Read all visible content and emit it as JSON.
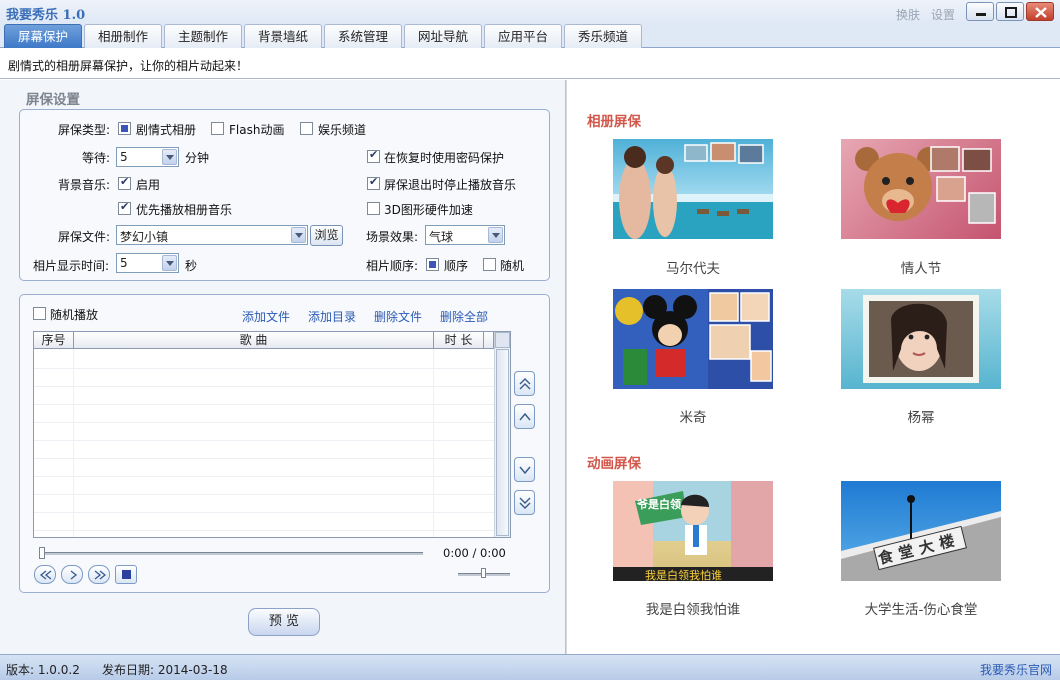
{
  "app": {
    "title": "我要秀乐 1.0",
    "skin_label": "换肤",
    "settings_label": "设置"
  },
  "tabs": [
    {
      "label": "屏幕保护",
      "active": true
    },
    {
      "label": "相册制作",
      "active": false
    },
    {
      "label": "主题制作",
      "active": false
    },
    {
      "label": "背景墙纸",
      "active": false
    },
    {
      "label": "系统管理",
      "active": false
    },
    {
      "label": "网址导航",
      "active": false
    },
    {
      "label": "应用平台",
      "active": false
    },
    {
      "label": "秀乐频道",
      "active": false
    }
  ],
  "subtitle": "剧情式的相册屏幕保护，让你的相片动起来！",
  "settings": {
    "section_title": "屏保设置",
    "type_label": "屏保类型:",
    "type_options": [
      "剧情式相册",
      "Flash动画",
      "娱乐频道"
    ],
    "wait_label": "等待:",
    "wait_value": "5",
    "wait_unit": "分钟",
    "password_label": "在恢复时使用密码保护",
    "bgm_label": "背景音乐:",
    "bgm_enable_label": "启用",
    "stop_music_label": "屏保退出时停止播放音乐",
    "priority_album_music_label": "优先播放相册音乐",
    "hw_accel_label": "3D图形硬件加速",
    "file_label": "屏保文件:",
    "file_value": "梦幻小镇",
    "browse_label": "浏览",
    "scene_effect_label": "场景效果:",
    "scene_effect_value": "气球",
    "photo_time_label": "相片显示时间:",
    "photo_time_value": "5",
    "photo_time_unit": "秒",
    "photo_order_label": "相片顺序:",
    "order_sequential_label": "顺序",
    "order_random_label": "随机"
  },
  "playlist": {
    "random_play_label": "随机播放",
    "add_file_label": "添加文件",
    "add_dir_label": "添加目录",
    "delete_file_label": "删除文件",
    "delete_all_label": "删除全部",
    "columns": [
      "序号",
      "歌 曲",
      "时 长"
    ],
    "time_display": "0:00 / 0:00"
  },
  "preview_label": "预 览",
  "right": {
    "album_title": "相册屏保",
    "animation_title": "动画屏保",
    "album_items": [
      "马尔代夫",
      "情人节",
      "米奇",
      "杨幂"
    ],
    "animation_items": [
      "我是白领我怕谁",
      "大学生活-伤心食堂"
    ],
    "anim_overlays": {
      "a1_caption": "我是白领我怕谁",
      "a1_sign": "爷是白领",
      "a2_sign": "食堂大楼"
    }
  },
  "status": {
    "version": "版本: 1.0.0.2",
    "release_date": "发布日期: 2014-03-18",
    "website_link": "我要秀乐官网"
  }
}
